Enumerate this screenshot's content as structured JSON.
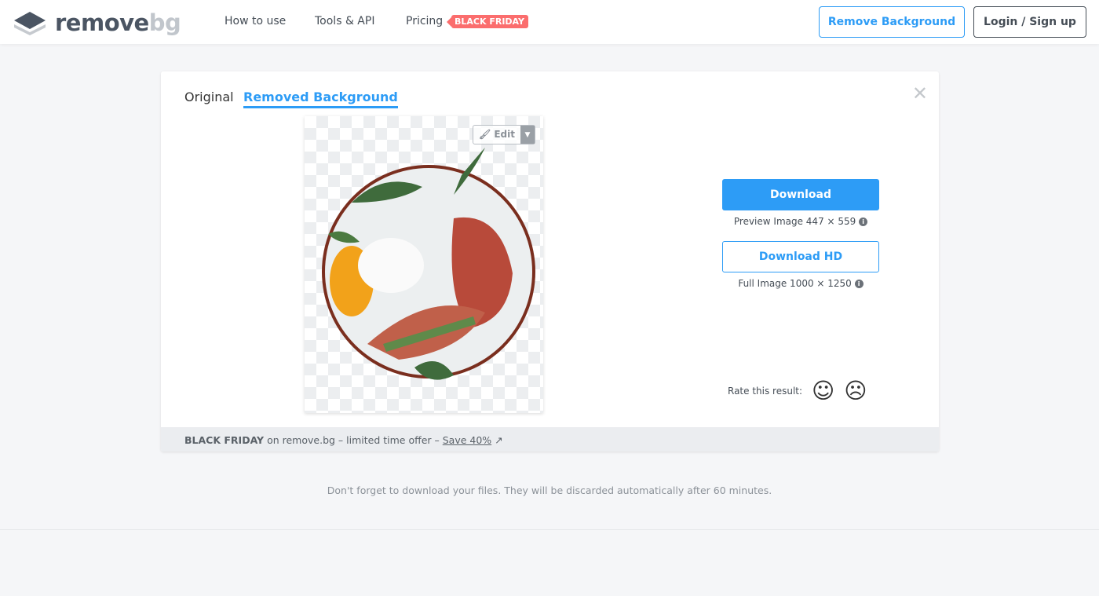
{
  "header": {
    "logo_main": "remove",
    "logo_accent": "bg",
    "nav": [
      "How to use",
      "Tools & API",
      "Pricing"
    ],
    "pricing_badge": "BLACK FRIDAY",
    "remove_bg_button": "Remove Background",
    "login_button": "Login / Sign up"
  },
  "card": {
    "tabs": [
      {
        "label": "Original",
        "active": false
      },
      {
        "label": "Removed Background",
        "active": true
      }
    ],
    "edit_label": "Edit",
    "download_label": "Download",
    "preview_info": "Preview Image 447 × 559",
    "download_hd_label": "Download HD",
    "full_info": "Full Image 1000 × 1250",
    "rate_label": "Rate this result:",
    "footer": {
      "bold": "BLACK FRIDAY",
      "text": " on remove.bg – limited time offer – ",
      "link": "Save 40%"
    }
  },
  "note": "Don't forget to download your files. They will be discarded automatically after 60 minutes.",
  "colors": {
    "accent": "#2d9cf6",
    "badge": "#fb6d6d"
  }
}
